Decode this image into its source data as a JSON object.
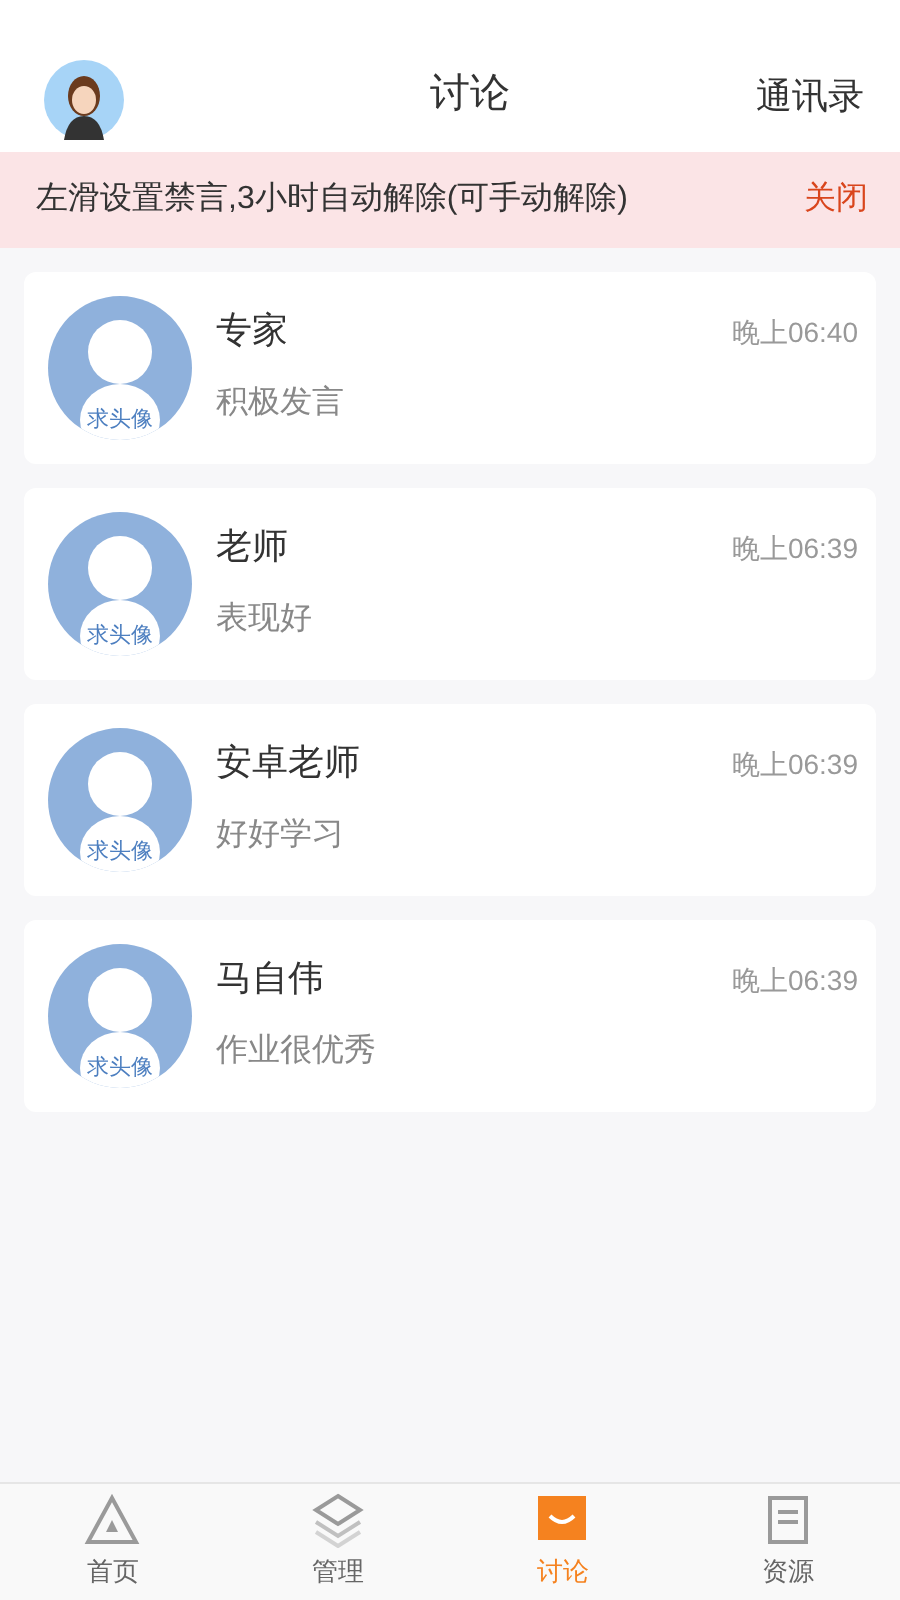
{
  "header": {
    "title": "讨论",
    "action": "通讯录"
  },
  "notice": {
    "text": "左滑设置禁言,3小时自动解除(可手动解除)",
    "close": "关闭"
  },
  "chats": [
    {
      "name": "专家",
      "message": "积极发言",
      "time": "晚上06:40",
      "avatar_label": "求头像"
    },
    {
      "name": "老师",
      "message": "表现好",
      "time": "晚上06:39",
      "avatar_label": "求头像"
    },
    {
      "name": "安卓老师",
      "message": "好好学习",
      "time": "晚上06:39",
      "avatar_label": "求头像"
    },
    {
      "name": "马自伟",
      "message": "作业很优秀",
      "time": "晚上06:39",
      "avatar_label": "求头像"
    }
  ],
  "tabs": [
    {
      "label": "首页",
      "kind": "home",
      "selected": false
    },
    {
      "label": "管理",
      "kind": "manage",
      "selected": false
    },
    {
      "label": "讨论",
      "kind": "discuss",
      "selected": true
    },
    {
      "label": "资源",
      "kind": "resource",
      "selected": false
    }
  ]
}
